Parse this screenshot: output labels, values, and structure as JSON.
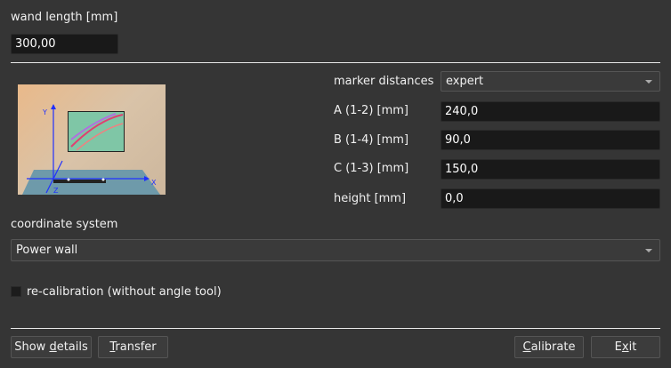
{
  "wand": {
    "label": "wand length [mm]",
    "value": "300,00"
  },
  "marker": {
    "label": "marker distances",
    "selected": "expert",
    "fields": [
      {
        "label": "A (1-2) [mm]",
        "value": "240,0"
      },
      {
        "label": "B (1-4) [mm]",
        "value": "90,0"
      },
      {
        "label": "C (1-3) [mm]",
        "value": "150,0"
      },
      {
        "label": "height [mm]",
        "value": "0,0"
      }
    ]
  },
  "illustration": {
    "axis_x": "X",
    "axis_y": "Y",
    "axis_z": "Z"
  },
  "coordinate": {
    "label": "coordinate system",
    "selected": "Power wall"
  },
  "recalibration": {
    "label": "re-calibration (without angle tool)",
    "checked": false
  },
  "buttons": {
    "show_details": {
      "pre": "Show ",
      "key": "d",
      "post": "etails"
    },
    "transfer": {
      "pre": "",
      "key": "T",
      "post": "ransfer"
    },
    "calibrate": {
      "pre": "",
      "key": "C",
      "post": "alibrate"
    },
    "exit": {
      "pre": "E",
      "key": "x",
      "post": "it"
    }
  }
}
